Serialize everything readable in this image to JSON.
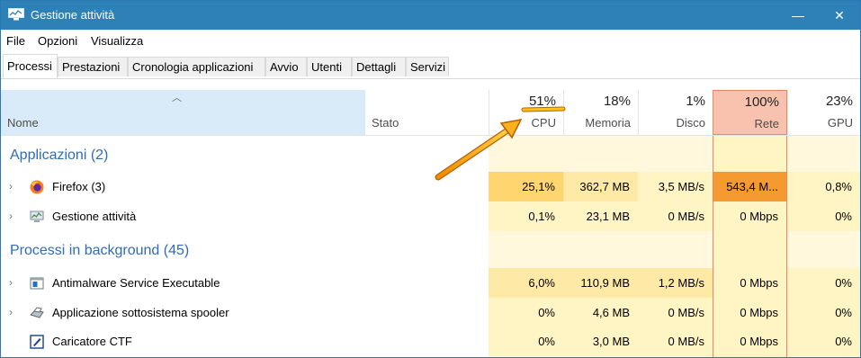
{
  "window": {
    "title": "Gestione attività",
    "minimize": "—",
    "close": "✕"
  },
  "menu": [
    "File",
    "Opzioni",
    "Visualizza"
  ],
  "tabs": [
    "Processi",
    "Prestazioni",
    "Cronologia applicazioni",
    "Avvio",
    "Utenti",
    "Dettagli",
    "Servizi"
  ],
  "columns": {
    "name": "Nome",
    "status": "Stato",
    "cpu": {
      "pct": "51%",
      "label": "CPU"
    },
    "memory": {
      "pct": "18%",
      "label": "Memoria"
    },
    "disk": {
      "pct": "1%",
      "label": "Disco"
    },
    "network": {
      "pct": "100%",
      "label": "Rete"
    },
    "gpu": {
      "pct": "23%",
      "label": "GPU"
    }
  },
  "groups": {
    "apps": "Applicazioni (2)",
    "background": "Processi in background (45)"
  },
  "rows": [
    {
      "name": "Firefox (3)",
      "icon": "firefox-icon",
      "cpu": "25,1%",
      "mem": "362,7 MB",
      "disk": "3,5 MB/s",
      "net": "543,4 M...",
      "gpu": "0,8%"
    },
    {
      "name": "Gestione attività",
      "icon": "task-manager-icon",
      "cpu": "0,1%",
      "mem": "23,1 MB",
      "disk": "0 MB/s",
      "net": "0 Mbps",
      "gpu": "0%"
    },
    {
      "name": "Antimalware Service Executable",
      "icon": "antimalware-icon",
      "cpu": "6,0%",
      "mem": "110,9 MB",
      "disk": "1,2 MB/s",
      "net": "0 Mbps",
      "gpu": "0%"
    },
    {
      "name": "Applicazione sottosistema spooler",
      "icon": "printer-icon",
      "cpu": "0%",
      "mem": "4,6 MB",
      "disk": "0 MB/s",
      "net": "0 Mbps",
      "gpu": "0%"
    },
    {
      "name": "Caricatore CTF",
      "icon": "ctf-loader-icon",
      "cpu": "0%",
      "mem": "3,0 MB",
      "disk": "0 MB/s",
      "net": "0 Mbps",
      "gpu": "0%"
    }
  ],
  "colors": {
    "titlebar": "#2d81b6",
    "group_header": "#2e6cb6",
    "heat_low": "#fff4c4",
    "heat_mid": "#fed56f",
    "heat_high": "#f59a30",
    "annotation_arrow": "#f08a00"
  }
}
